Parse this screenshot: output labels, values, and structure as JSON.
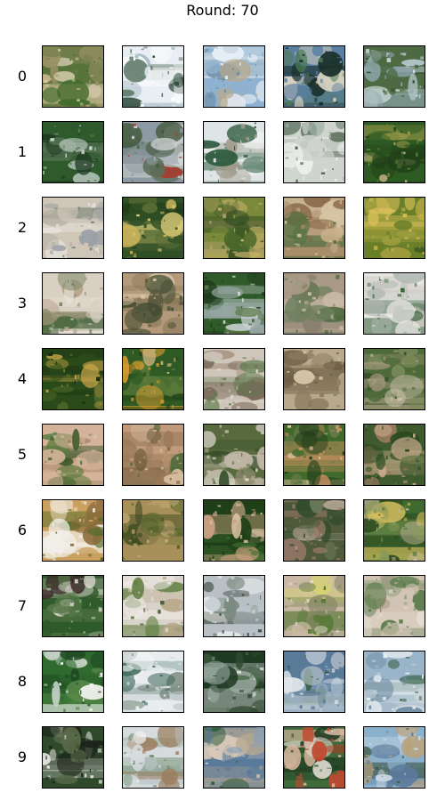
{
  "title": "Round: 70",
  "rows": [
    {
      "label": "0",
      "tiles": [
        {
          "palette": [
            "#6f7d4b",
            "#c7b48a",
            "#3f6b2a",
            "#9a9166",
            "#d9cfb3"
          ]
        },
        {
          "palette": [
            "#e8eef3",
            "#2f4a3b",
            "#9fb4bf",
            "#5f7b6a",
            "#ffffff"
          ]
        },
        {
          "palette": [
            "#8fb2d0",
            "#c9d9e5",
            "#6c8ba6",
            "#b7a98c",
            "#e7eef5"
          ]
        },
        {
          "palette": [
            "#5a7fa3",
            "#1a2f2a",
            "#d8d2bf",
            "#4e7a52",
            "#9bbad3"
          ]
        },
        {
          "palette": [
            "#4d6a43",
            "#b5c9cf",
            "#2f4a2f",
            "#8aa4a8",
            "#d9e3e6"
          ]
        }
      ]
    },
    {
      "label": "1",
      "tiles": [
        {
          "palette": [
            "#2f5a2c",
            "#e8eef1",
            "#5d7c5a",
            "#c7d0c7",
            "#1f3a22"
          ]
        },
        {
          "palette": [
            "#8e9aa3",
            "#5c6e58",
            "#d4d8d9",
            "#a43c2e",
            "#3f5538"
          ]
        },
        {
          "palette": [
            "#dfe5e6",
            "#2e5a3e",
            "#a09b8c",
            "#6d8b7a",
            "#f2f4f2"
          ]
        },
        {
          "palette": [
            "#cfd4cf",
            "#4b5f4a",
            "#9fb0a4",
            "#eef0ee",
            "#6d7f6f"
          ]
        },
        {
          "palette": [
            "#2e5a23",
            "#9a9a4a",
            "#c9b88a",
            "#5c7a2f",
            "#1f3f18"
          ]
        }
      ]
    },
    {
      "label": "2",
      "tiles": [
        {
          "palette": [
            "#cfc6b8",
            "#9aa0a6",
            "#e6e1da",
            "#6c7a6a",
            "#b5b0a4"
          ]
        },
        {
          "palette": [
            "#2f4f25",
            "#c8b25a",
            "#5a6e35",
            "#e0cf7a",
            "#1f3a18"
          ]
        },
        {
          "palette": [
            "#7a8a3a",
            "#c9b36a",
            "#4e6a2c",
            "#a99a6a",
            "#2f4a20"
          ]
        },
        {
          "palette": [
            "#a88d6a",
            "#4f7040",
            "#c9b08a",
            "#8a6a4a",
            "#d6c4a4"
          ]
        },
        {
          "palette": [
            "#6a7f2a",
            "#c9b24a",
            "#3f5a1f",
            "#a0a040",
            "#d8c05a"
          ]
        }
      ]
    },
    {
      "label": "3",
      "tiles": [
        {
          "palette": [
            "#d9cfc2",
            "#7d8a6a",
            "#b8a38a",
            "#eae3da",
            "#4f6a42"
          ]
        },
        {
          "palette": [
            "#b49a7a",
            "#5c5a3e",
            "#d6c1a3",
            "#3f4a30",
            "#8a7a5a"
          ]
        },
        {
          "palette": [
            "#2f5a2a",
            "#cfd4d8",
            "#5a7a4a",
            "#1f3a1c",
            "#9aa8a8"
          ]
        },
        {
          "palette": [
            "#a89a86",
            "#6f7f5f",
            "#c9bba8",
            "#4f6a3f",
            "#8a8070"
          ]
        },
        {
          "palette": [
            "#e8e6e3",
            "#2f5a30",
            "#b0b8b3",
            "#5a7a5c",
            "#cfcac2"
          ]
        }
      ]
    },
    {
      "label": "4",
      "tiles": [
        {
          "palette": [
            "#2a4a1a",
            "#9a8a3a",
            "#4f6a2a",
            "#c9a84a",
            "#1a3012"
          ]
        },
        {
          "palette": [
            "#2f5a23",
            "#e0a030",
            "#5a7a3a",
            "#c9b07a",
            "#1f3f18"
          ]
        },
        {
          "palette": [
            "#cfc6bb",
            "#7a6a5a",
            "#e4ddd2",
            "#5a7a4a",
            "#a89582"
          ]
        },
        {
          "palette": [
            "#b9a98c",
            "#6a5a42",
            "#d6c7a8",
            "#4f6a3a",
            "#8a7a5e"
          ]
        },
        {
          "palette": [
            "#4f6a3a",
            "#a89a82",
            "#2f4a2a",
            "#cfc4b0",
            "#7a8a5a"
          ]
        }
      ]
    },
    {
      "label": "5",
      "tiles": [
        {
          "palette": [
            "#d4b39a",
            "#5a7a3c",
            "#e6d2c2",
            "#9a7a5a",
            "#3f5a2e"
          ]
        },
        {
          "palette": [
            "#c09a7a",
            "#6a5a3a",
            "#d8bfa2",
            "#4f6a3a",
            "#9a7a5a"
          ]
        },
        {
          "palette": [
            "#5a6a3f",
            "#c2b8a8",
            "#2f4a24",
            "#8a8a6a",
            "#dcd6cc"
          ]
        },
        {
          "palette": [
            "#3f6a2c",
            "#c89060",
            "#6a7a4a",
            "#e0c4a4",
            "#1f3a18"
          ]
        },
        {
          "palette": [
            "#3f5a2e",
            "#c9a98c",
            "#6a7a4a",
            "#9a7a60",
            "#2a4a1f"
          ]
        }
      ]
    },
    {
      "label": "6",
      "tiles": [
        {
          "palette": [
            "#c9a060",
            "#4f6a2a",
            "#e6d6b0",
            "#8a6a3a",
            "#f2f0ea"
          ]
        },
        {
          "palette": [
            "#a8905a",
            "#5a6a2f",
            "#c9b07a",
            "#3f4a22",
            "#8a7a4a"
          ]
        },
        {
          "palette": [
            "#1f3f18",
            "#c9a080",
            "#3f6a2f",
            "#9a8a6a",
            "#e0c8a8"
          ]
        },
        {
          "palette": [
            "#4f5a3a",
            "#9a7a6a",
            "#2f4a2a",
            "#c2b0a0",
            "#6a7a5a"
          ]
        },
        {
          "palette": [
            "#3f6a2f",
            "#d8c060",
            "#8a9a5a",
            "#c9b8a0",
            "#2a4a20"
          ]
        }
      ]
    },
    {
      "label": "7",
      "tiles": [
        {
          "palette": [
            "#2f5a2a",
            "#e2dcd6",
            "#5a7a4a",
            "#3a2a2a",
            "#9aa890"
          ]
        },
        {
          "palette": [
            "#d8d2c8",
            "#5a7a3a",
            "#b8a88a",
            "#eeeae4",
            "#3f5a30"
          ]
        },
        {
          "palette": [
            "#b8c0c6",
            "#3a4a40",
            "#d6d6d2",
            "#7a8a80",
            "#e8eaec"
          ]
        },
        {
          "palette": [
            "#c9b8a4",
            "#5a7a3a",
            "#d8d86a",
            "#8a8a6a",
            "#e6dcd0"
          ]
        },
        {
          "palette": [
            "#d2c4b4",
            "#5a7a4a",
            "#e6dcd0",
            "#8a9a7a",
            "#b0a08a"
          ]
        }
      ]
    },
    {
      "label": "8",
      "tiles": [
        {
          "palette": [
            "#2f6a2f",
            "#f2f2ee",
            "#5a8a4a",
            "#c9d4cc",
            "#1f4a22"
          ]
        },
        {
          "palette": [
            "#e8ecee",
            "#3f6a5a",
            "#b8c4c6",
            "#7a8a80",
            "#f6f8f8"
          ]
        },
        {
          "palette": [
            "#1f3a22",
            "#d8ddd8",
            "#4a6a4a",
            "#9aa8a0",
            "#2f4a30"
          ]
        },
        {
          "palette": [
            "#5a7a9a",
            "#e0e6ea",
            "#2f5a3a",
            "#9ab0c4",
            "#c4ccd0"
          ]
        },
        {
          "palette": [
            "#9ab4c9",
            "#e8eef2",
            "#2f5a3a",
            "#c9d4da",
            "#6a8aa0"
          ]
        }
      ]
    },
    {
      "label": "9",
      "tiles": [
        {
          "palette": [
            "#2f4a2a",
            "#e8e8e4",
            "#5a6a4a",
            "#1a2418",
            "#b8bcb4"
          ]
        },
        {
          "palette": [
            "#d6dcde",
            "#6a8a6a",
            "#b8c2c4",
            "#9a7a5a",
            "#eef0f0"
          ]
        },
        {
          "palette": [
            "#5a7a9a",
            "#d8c8b8",
            "#2f5a3a",
            "#b8a890",
            "#8aa0b4"
          ]
        },
        {
          "palette": [
            "#3f6a3a",
            "#d8b8a0",
            "#c04a30",
            "#eae4dc",
            "#1f3a22"
          ]
        },
        {
          "palette": [
            "#8ab0cc",
            "#5a7a9a",
            "#c9d8e2",
            "#b8a07a",
            "#3f5a4a"
          ]
        }
      ]
    }
  ]
}
